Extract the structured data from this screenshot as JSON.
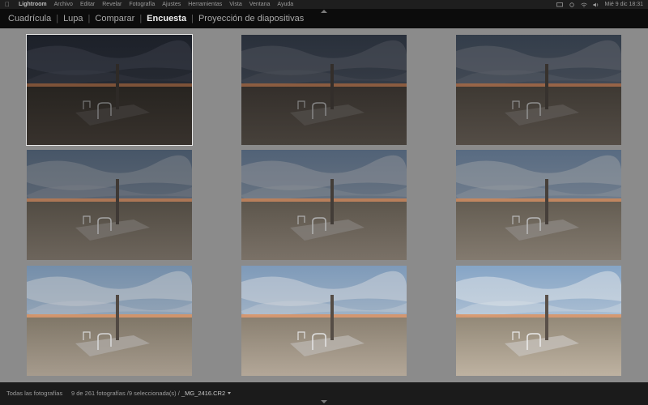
{
  "menubar": {
    "app": "Lightroom",
    "items": [
      "Archivo",
      "Editar",
      "Revelar",
      "Fotografía",
      "Ajustes",
      "Herramientas",
      "Vista",
      "Ventana",
      "Ayuda"
    ],
    "clock": "Mié 9 dic  18:31",
    "icons": [
      "apple-icon",
      "display-icon",
      "sync-icon",
      "wifi-icon",
      "volume-icon"
    ]
  },
  "modes": {
    "items": [
      "Cuadrícula",
      "Lupa",
      "Comparar",
      "Encuesta",
      "Proyección de diapositivas"
    ],
    "active": "Encuesta"
  },
  "survey": {
    "photos": [
      {
        "exposure": 0.08,
        "selected": true
      },
      {
        "exposure": 0.18,
        "selected": false
      },
      {
        "exposure": 0.26,
        "selected": false
      },
      {
        "exposure": 0.42,
        "selected": false
      },
      {
        "exposure": 0.5,
        "selected": false
      },
      {
        "exposure": 0.56,
        "selected": false
      },
      {
        "exposure": 0.78,
        "selected": false
      },
      {
        "exposure": 0.86,
        "selected": false
      },
      {
        "exposure": 0.93,
        "selected": false
      }
    ]
  },
  "status": {
    "source": "Todas las fotografías",
    "count": "9 de 261 fotografías /9 seleccionada(s) /",
    "filename": "_MG_2416.CR2"
  },
  "colors": {
    "sky_dark": "#1a1d24",
    "sky_light": "#b7cbe0",
    "sunset": "#e0905a",
    "sand_dark": "#2b2622",
    "sand_light": "#c9bcab",
    "accent_active": "#f0f0f0"
  }
}
